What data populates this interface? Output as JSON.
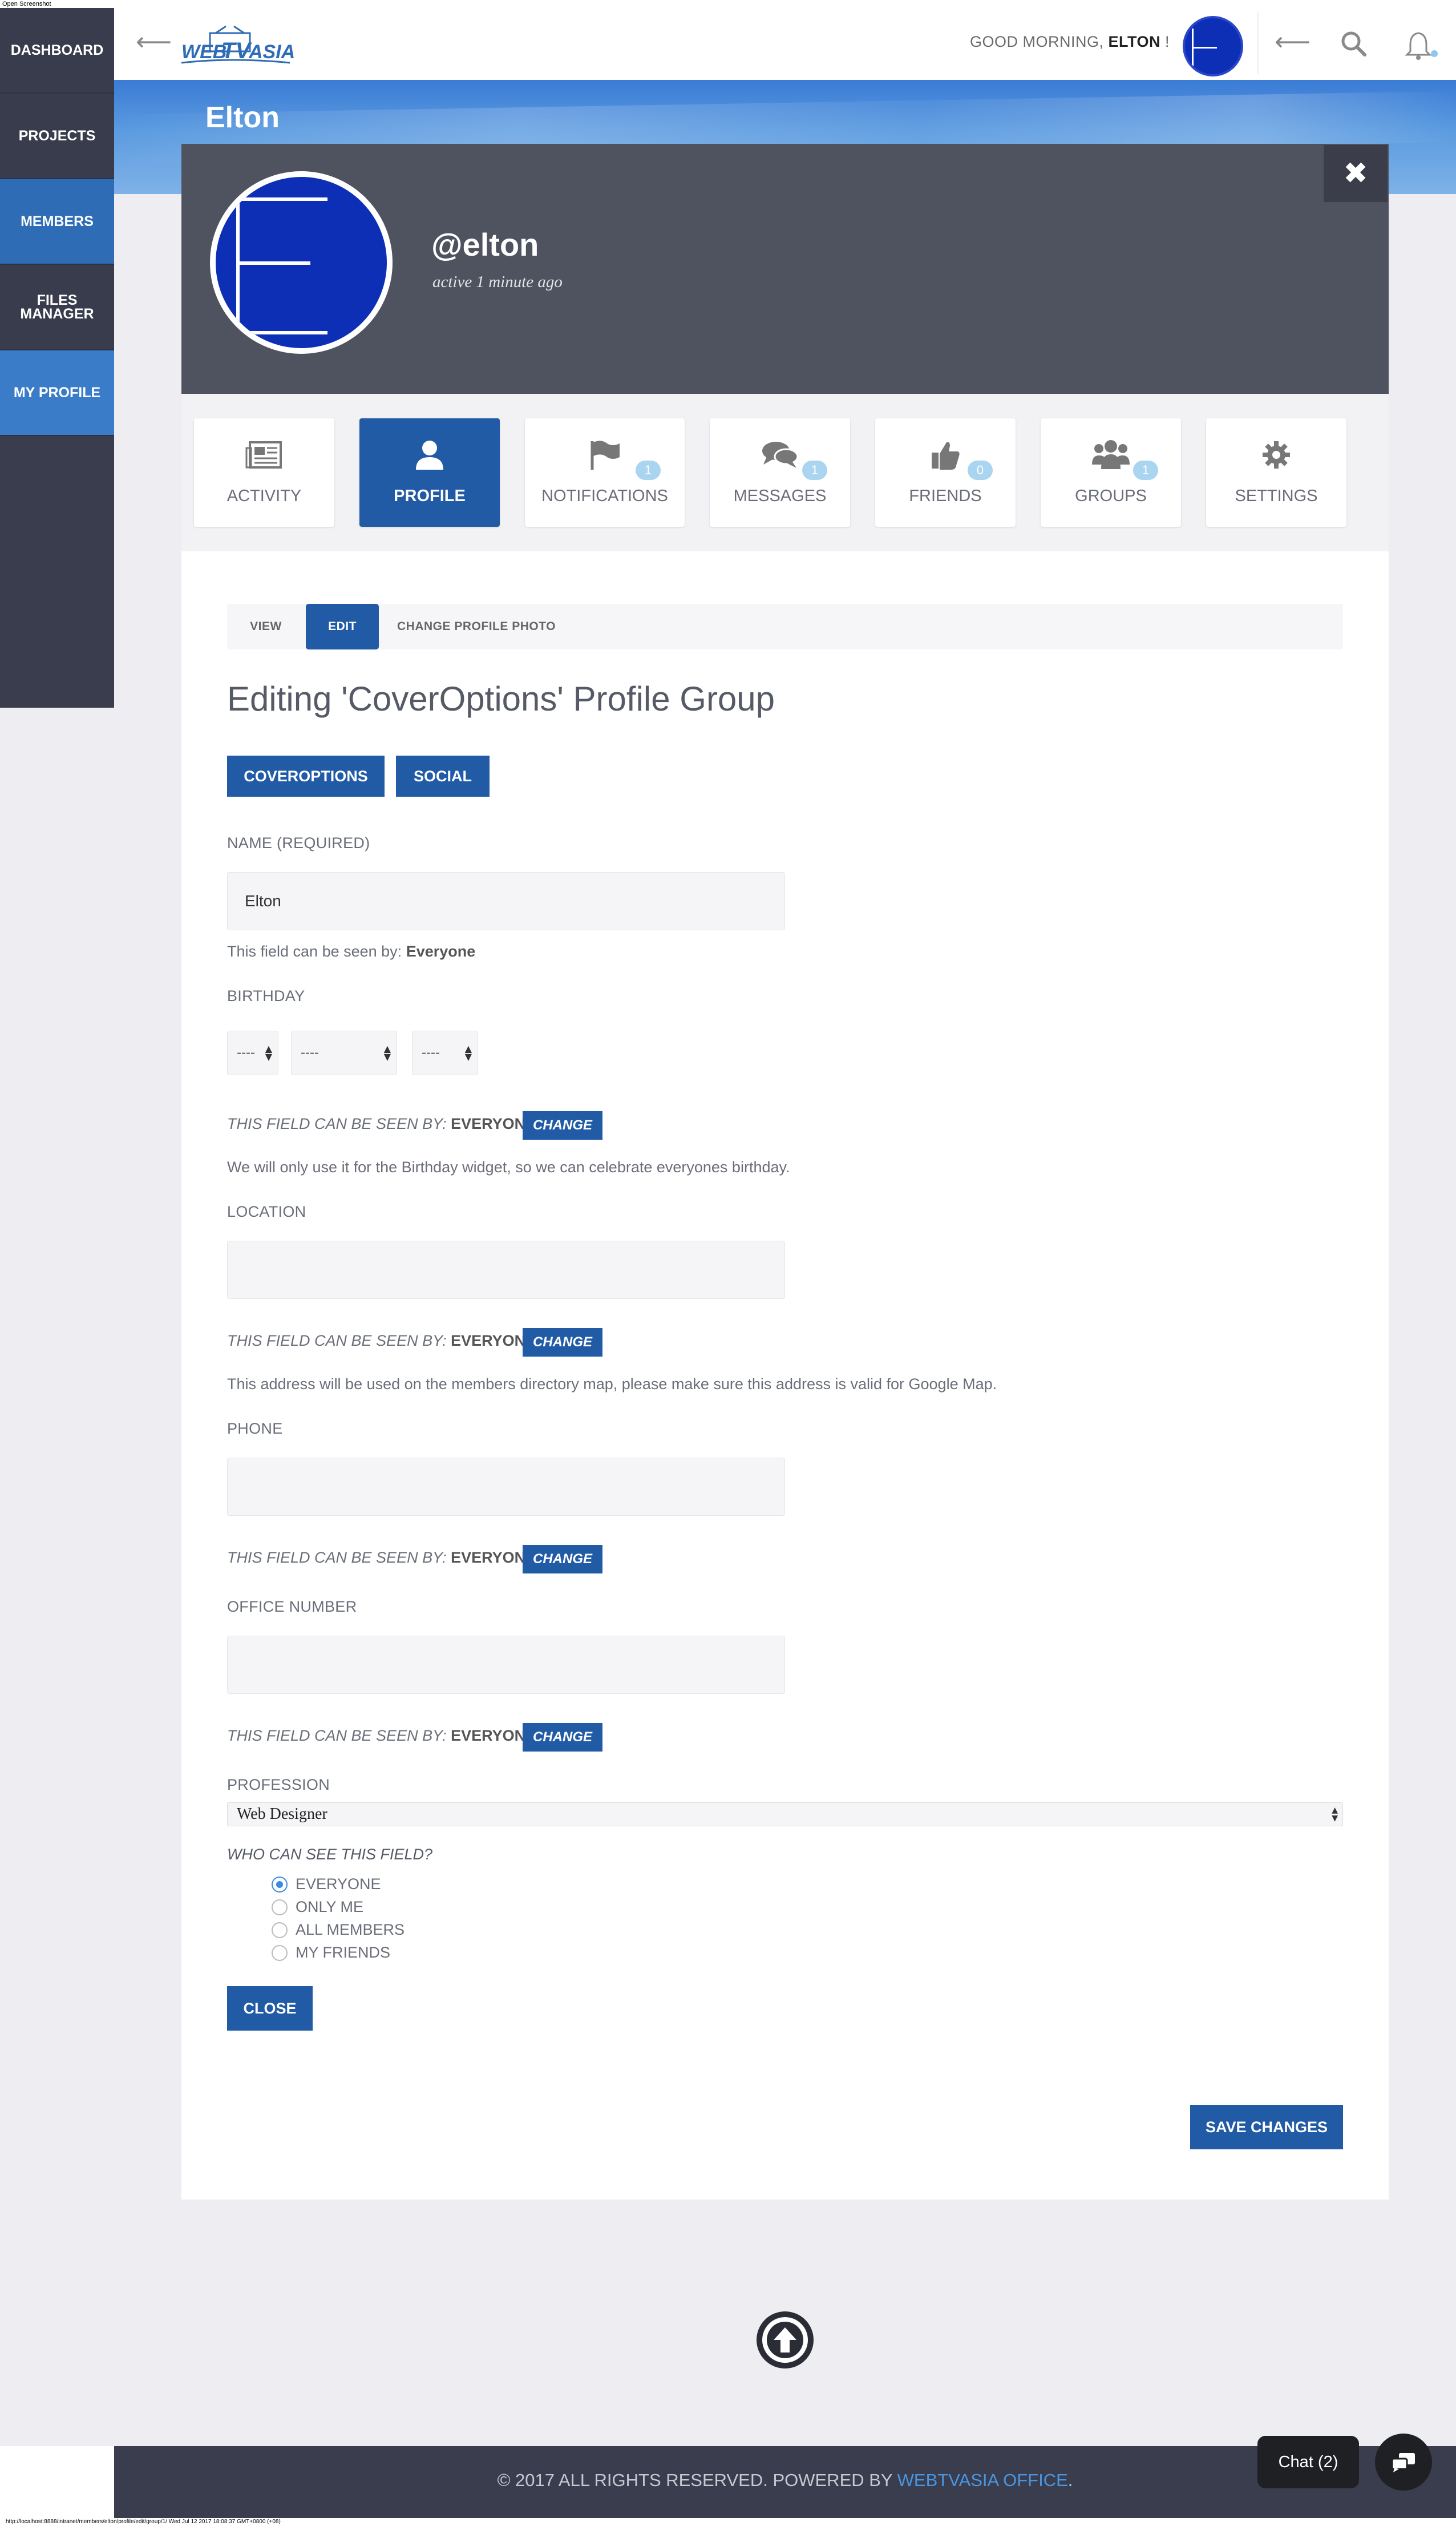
{
  "window": {
    "top_label": "Open Screenshot"
  },
  "sidebar": {
    "items": [
      {
        "label": "DASHBOARD"
      },
      {
        "label": "PROJECTS"
      },
      {
        "label": "MEMBERS"
      },
      {
        "label": "FILES MANAGER"
      },
      {
        "label": "MY PROFILE"
      }
    ]
  },
  "header": {
    "logo_text": "WEBTVASIA",
    "greeting_prefix": "GOOD MORNING, ",
    "greeting_name": "ELTON",
    "greeting_suffix": " !"
  },
  "banner": {
    "name": "Elton"
  },
  "profile": {
    "handle": "@elton",
    "activity": "active 1 minute ago"
  },
  "tabs": [
    {
      "label": "ACTIVITY",
      "icon": "newspaper-icon",
      "badge": ""
    },
    {
      "label": "PROFILE",
      "icon": "user-icon",
      "badge": ""
    },
    {
      "label": "NOTIFICATIONS",
      "icon": "flag-icon",
      "badge": "1"
    },
    {
      "label": "MESSAGES",
      "icon": "comments-icon",
      "badge": "1"
    },
    {
      "label": "FRIENDS",
      "icon": "thumbs-up-icon",
      "badge": "0"
    },
    {
      "label": "GROUPS",
      "icon": "users-icon",
      "badge": "1"
    },
    {
      "label": "SETTINGS",
      "icon": "gear-icon",
      "badge": ""
    }
  ],
  "subnav": {
    "view": "VIEW",
    "edit": "EDIT",
    "change_photo": "CHANGE PROFILE PHOTO"
  },
  "edit_title": "Editing 'CoverOptions' Profile Group",
  "group_buttons": {
    "coveroptions": "COVEROPTIONS",
    "social": "SOCIAL"
  },
  "fields": {
    "name": {
      "label": "NAME (REQUIRED)",
      "value": "Elton",
      "vis_prefix": "This field can be seen by: ",
      "vis_value": "Everyone"
    },
    "birthday": {
      "label": "BIRTHDAY",
      "day": "----",
      "month": "----",
      "year": "----",
      "vis_prefix": "THIS FIELD CAN BE SEEN BY: ",
      "vis_value": "EVERYONE",
      "change": "CHANGE",
      "description": "We will only use it for the Birthday widget, so we can celebrate everyones birthday."
    },
    "location": {
      "label": "LOCATION",
      "value": "",
      "vis_prefix": "THIS FIELD CAN BE SEEN BY: ",
      "vis_value": "EVERYONE",
      "change": "CHANGE",
      "description": "This address will be used on the members directory map, please make sure this address is valid for Google Map."
    },
    "phone": {
      "label": "PHONE",
      "value": "",
      "vis_prefix": "THIS FIELD CAN BE SEEN BY: ",
      "vis_value": "EVERYONE",
      "change": "CHANGE"
    },
    "office": {
      "label": "OFFICE NUMBER",
      "value": "",
      "vis_prefix": "THIS FIELD CAN BE SEEN BY: ",
      "vis_value": "EVERYONE",
      "change": "CHANGE"
    },
    "profession": {
      "label": "PROFESSION",
      "value": "Web Designer"
    }
  },
  "visibility": {
    "question": "WHO CAN SEE THIS FIELD?",
    "options": [
      "EVERYONE",
      "ONLY ME",
      "ALL MEMBERS",
      "MY FRIENDS"
    ],
    "selected": "EVERYONE",
    "close": "CLOSE"
  },
  "save_label": "SAVE CHANGES",
  "footer": {
    "text": "© 2017 ALL RIGHTS RESERVED. POWERED BY ",
    "link": "WEBTVASIA OFFICE",
    "end": "."
  },
  "chat": {
    "label": "Chat (2)"
  },
  "statusbar": {
    "text": "http://localhost:8888/intranet/members/elton/profile/edit/group/1/ Wed Jul 12 2017 18:08:37 GMT+0800 (+08)"
  },
  "colors": {
    "primary": "#215ba6",
    "sidebar": "#3a3d4d",
    "members_active": "#2f6cb6",
    "badge": "#a9d5f0"
  }
}
